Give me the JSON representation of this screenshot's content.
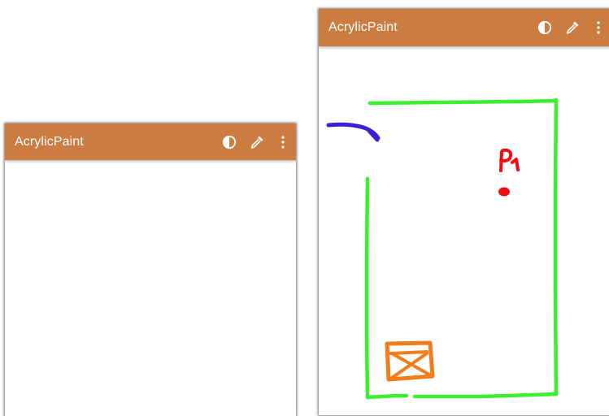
{
  "colors": {
    "appbar": "#cb7d41",
    "stroke_green": "#3cf02f",
    "stroke_blue": "#3a20d8",
    "stroke_red": "#f20a10",
    "stroke_orange": "#f07d19"
  },
  "left_screen": {
    "app_title": "AcrylicPaint",
    "icons": [
      "contrast-icon",
      "color-picker-icon",
      "more-vert-icon"
    ]
  },
  "right_screen": {
    "app_title": "AcrylicPaint",
    "icons": [
      "contrast-icon",
      "color-picker-icon",
      "more-vert-icon"
    ],
    "drawing": {
      "handwritten_label": "P1"
    }
  }
}
